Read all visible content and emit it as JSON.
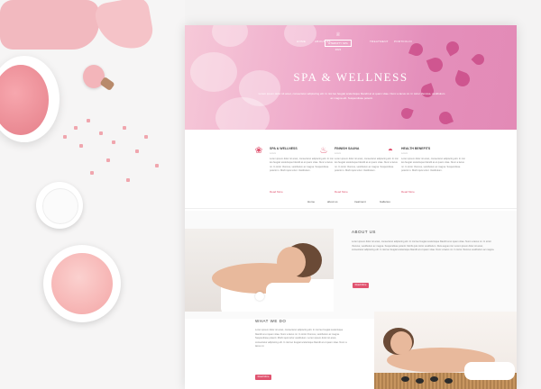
{
  "hero": {
    "nav": [
      "HOME",
      "ABOUT US",
      "TREATMENT",
      "PORTFOLIO"
    ],
    "logo_text": "ETERNITY SPA",
    "logo_year": "2021",
    "title": "SPA & WELLNESS",
    "subtitle": "Lorem ipsum dolor sit amet, consectetur adipiscing elit. In nisi leo feugiat scelerisque blandit at et quam vitae. Nunc a lacus mi. In tortor rhoncus, vestibulum ac magna elit. Suspendisse potenti."
  },
  "features": [
    {
      "icon": "lotus-icon",
      "title": "SPA & WELLNESS",
      "sub": "Lorem",
      "text": "Lorem ipsum dolor sit amet, consectetur adipiscing elit. In nisi leo feugiat scelerisque blandit at et quam vitae. Nunc a lacus mi. In tortor rhoncus, vestibulum ac magna. Suspendisse potenti in. Morbi quis tortor. Vestibulum.",
      "link": "Read More"
    },
    {
      "icon": "candle-icon",
      "title": "FINNISH SAUNA",
      "sub": "Lorem",
      "text": "Lorem ipsum dolor sit amet, consectetur adipiscing elit. In nisi leo feugiat scelerisque blandit at et quam vitae. Nunc a lacus mi. In tortor rhoncus, vestibulum ac magna. Suspendisse potenti in. Morbi quis tortor. Vestibulum.",
      "link": "Read More"
    },
    {
      "icon": "bowl-icon",
      "title": "HEALTH BENEFITS",
      "sub": "Lorem",
      "text": "Lorem ipsum dolor sit amet, consectetur adipiscing elit. In nisi leo feugiat scelerisque blandit at et quam vitae. Nunc a lacus mi. In tortor rhoncus, vestibulum ac magna. Suspendisse potenti in. Morbi quis tortor. Vestibulum.",
      "link": "Read More"
    }
  ],
  "subnav": [
    "Home",
    "about us",
    "treatment",
    "Galleries"
  ],
  "about": {
    "title": "ABOUT US",
    "text": "Lorem ipsum dolor sit amet, consectetur adipiscing elit. In nisi leo feugiat scelerisque blandit at et quam vitae. Nunc a lacus mi. In tortor rhoncus, vestibulum ac magna. Suspendisse potenti. Morbi quis tortor vestibulum. Duis augue nisl. Lorem ipsum dolor sit amet, consectetur adipiscing elit. In nisi leo feugiat scelerisque blandit at et quam vitae. Nunc a lacus mi. In tortor rhoncus vestibulum ac magna.",
    "button": "Read More"
  },
  "what_we_do": {
    "title": "WHAT WE DO",
    "text": "Lorem ipsum dolor sit amet, consectetur adipiscing elit. In nisi leo feugiat scelerisque blandit at et quam vitae. Nunc a lacus mi. In tortor rhoncus, vestibulum ac magna. Suspendisse potenti. Morbi quis tortor vestibulum. Lorem ipsum dolor sit amet, consectetur adipiscing elit. In nisi leo feugiat scelerisque blandit at et quam vitae. Nunc a lacus mi.",
    "button": "Read More"
  },
  "colors": {
    "accent": "#e0536f",
    "hero_pink": "#e48fbb"
  }
}
